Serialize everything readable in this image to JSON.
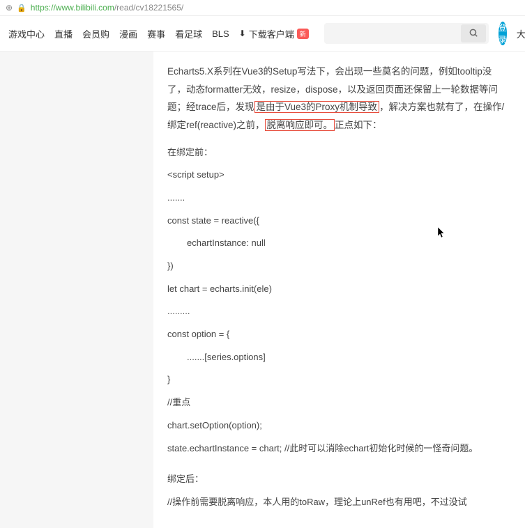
{
  "browser": {
    "url_prefix": "https://",
    "url_host": "www.bilibili.com",
    "url_path": "/read/cv18221565/"
  },
  "nav": {
    "items": [
      "游戏中心",
      "直播",
      "会员购",
      "漫画",
      "赛事",
      "看足球",
      "BLS"
    ],
    "download": "下载客户端",
    "badge": "新",
    "login": "登录",
    "right": "大会"
  },
  "article": {
    "intro_p1_a": "Echarts5.X系列在Vue3的Setup写法下，会出现一些莫名的问题，例如tooltip没了，动态formatter无效，resize，dispose，以及返回页面还保留上一轮数据等问题；经trace后，发现",
    "intro_hl1": "是由于Vue3的Proxy机制导致",
    "intro_p1_b": "，解决方案也就有了，在操作/绑定ref(reactive)之前，",
    "intro_hl2": "脱离响应即可。",
    "intro_p1_c": "正点如下：",
    "before_bind": "在绑定前：",
    "line_script": "<script setup>",
    "line_dots1": ".......",
    "line_const_state": "const state = reactive({",
    "line_echart_null": "echartInstance: null",
    "line_close_brace": "})",
    "line_let_chart": "let chart = echarts.init(ele)",
    "line_dots2": ".........",
    "line_const_option": "const option = {",
    "line_series": ".......[series.options]",
    "line_close2": "}",
    "line_comment": "//重点",
    "line_setoption": "chart.setOption(option);",
    "line_assign": "state.echartInstance = chart; //此时可以消除echart初始化时候的一怪奇问题。",
    "after_bind": "绑定后：",
    "line_after": "//操作前需要脱离响应，本人用的toRaw，理论上unRef也有用吧，不过没试"
  }
}
